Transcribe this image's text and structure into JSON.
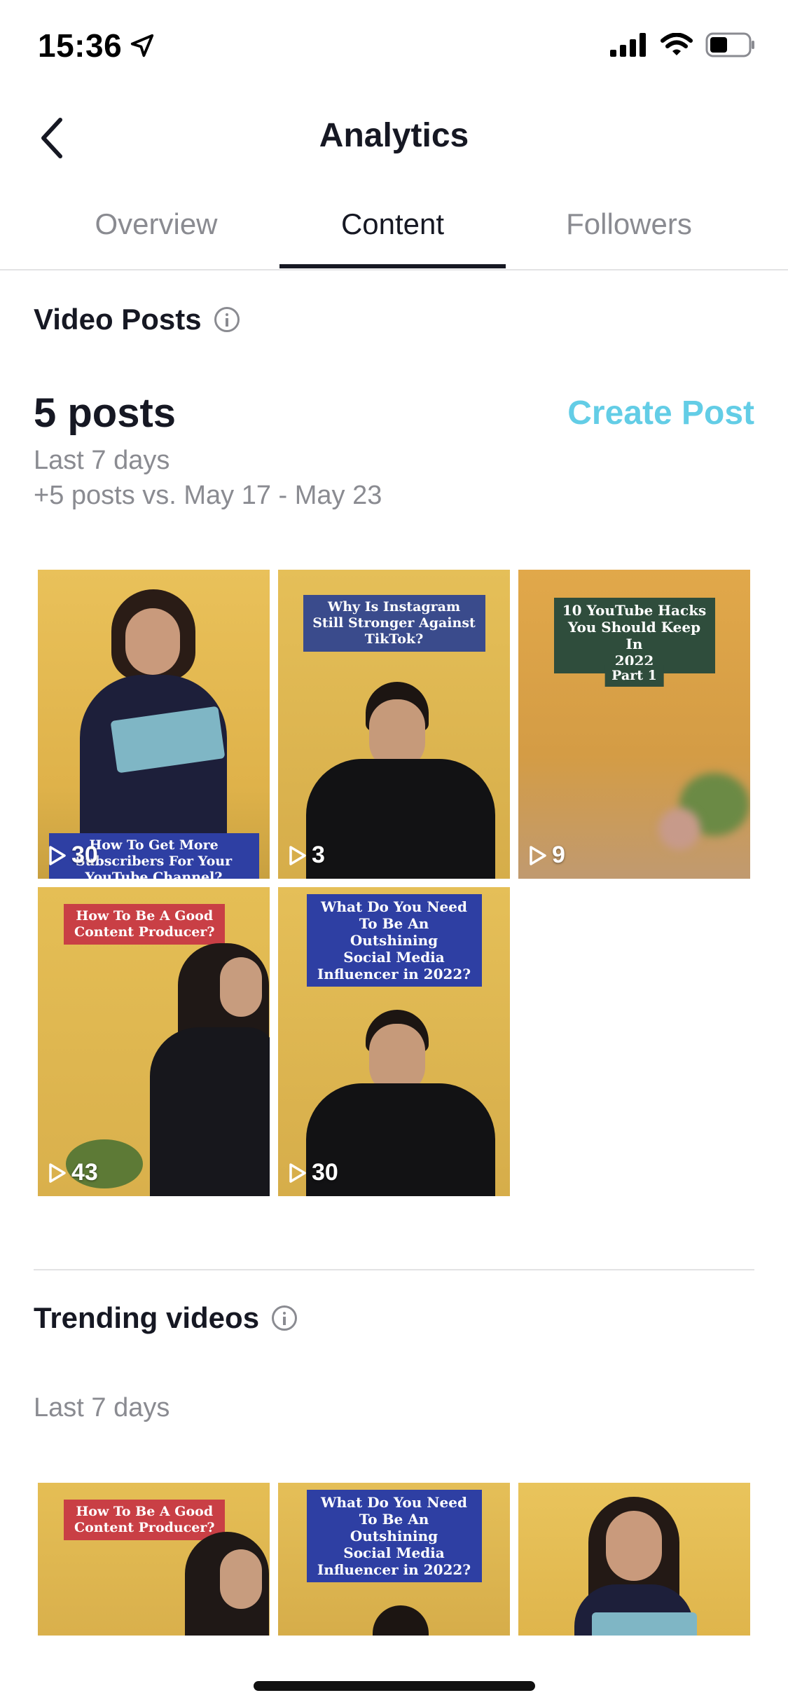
{
  "status_bar": {
    "time": "15:36"
  },
  "header": {
    "title": "Analytics"
  },
  "tabs": [
    {
      "label": "Overview"
    },
    {
      "label": "Content"
    },
    {
      "label": "Followers"
    }
  ],
  "video_posts": {
    "title": "Video Posts",
    "count_label": "5 posts",
    "create_label": "Create Post",
    "period": "Last 7 days",
    "comparison": "+5 posts vs. May 17 - May 23",
    "items": [
      {
        "views": "30",
        "caption": "How To Get More\nSubscribers For Your\nYouTube Channel?"
      },
      {
        "views": "3",
        "caption": "Why Is Instagram\nStill Stronger Against\nTikTok?"
      },
      {
        "views": "9",
        "caption": "10 YouTube Hacks\nYou Should Keep In\n2022",
        "caption2": "Part 1"
      },
      {
        "views": "43",
        "caption": "How To Be A Good\nContent Producer?"
      },
      {
        "views": "30",
        "caption": "What Do You Need\nTo Be An Outshining\nSocial Media\nInfluencer in 2022?"
      }
    ]
  },
  "trending": {
    "title": "Trending videos",
    "period": "Last 7 days",
    "items": [
      {
        "caption": "How To Be A Good\nContent Producer?"
      },
      {
        "caption": "What Do You Need\nTo Be An Outshining\nSocial Media\nInfluencer in 2022?"
      },
      {
        "caption": ""
      }
    ]
  },
  "colors": {
    "accent": "#63cde6",
    "text": "#161823",
    "muted": "#8a8b91"
  }
}
